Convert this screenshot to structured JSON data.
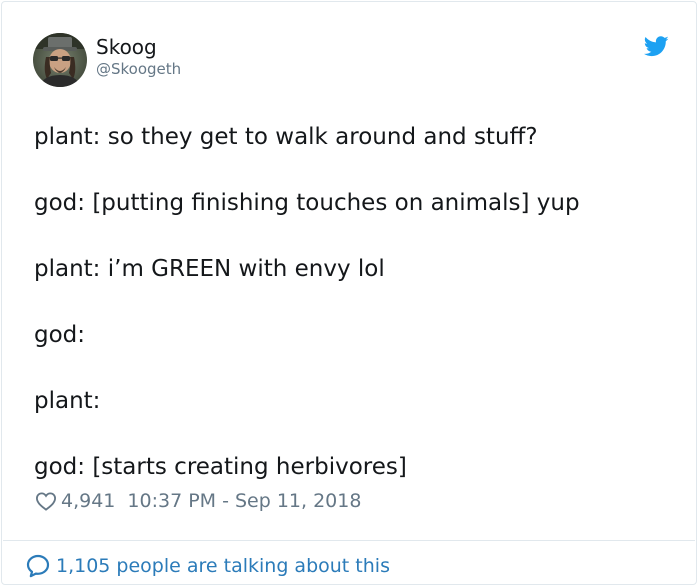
{
  "user": {
    "display_name": "Skoog",
    "handle": "@Skoogeth"
  },
  "tweet": {
    "lines": [
      "plant: so they get to walk around and stuff?",
      "god: [putting finishing touches on animals] yup",
      "plant: i’m GREEN with envy lol",
      "god:",
      "plant:",
      "god: [starts creating herbivores]"
    ],
    "likes": "4,941",
    "timestamp": "10:37 PM - Sep 11, 2018"
  },
  "footer": {
    "label": "1,105 people are talking about this"
  },
  "icons": {
    "bird": "twitter-bird-icon",
    "heart": "heart-icon",
    "bubble": "comment-bubble-icon"
  },
  "colors": {
    "twitter_blue": "#1da1f2",
    "link_blue": "#2b7bb9",
    "text": "#14171a",
    "muted": "#657786",
    "border": "#e1e8ed"
  }
}
